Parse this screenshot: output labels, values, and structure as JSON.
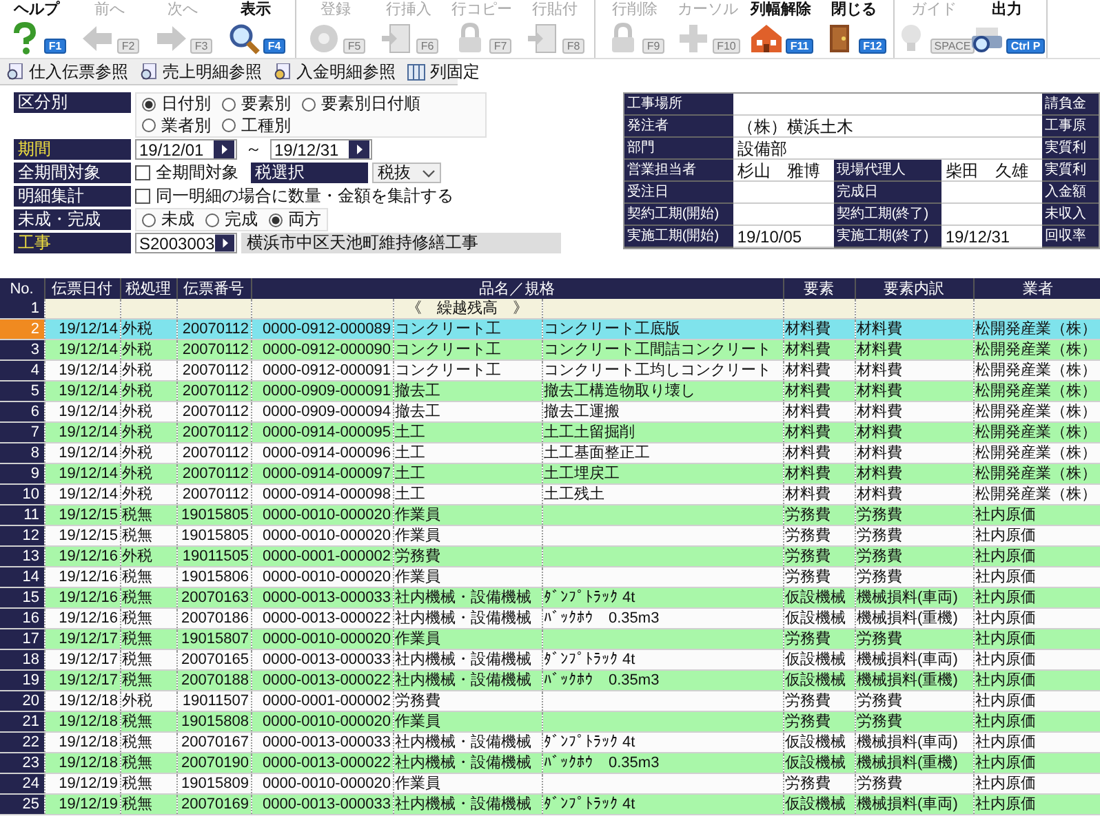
{
  "toolbar_groups": [
    {
      "buttons": [
        {
          "label": "ヘルプ",
          "key": "F1",
          "disabled": false
        },
        {
          "label": "前へ",
          "key": "F2",
          "disabled": true
        },
        {
          "label": "次へ",
          "key": "F3",
          "disabled": true
        },
        {
          "label": "表示",
          "key": "F4",
          "disabled": false
        }
      ]
    },
    {
      "buttons": [
        {
          "label": "登録",
          "key": "F5",
          "disabled": true
        },
        {
          "label": "行挿入",
          "key": "F6",
          "disabled": true
        },
        {
          "label": "行コピー",
          "key": "F7",
          "disabled": true
        },
        {
          "label": "行貼付",
          "key": "F8",
          "disabled": true
        }
      ]
    },
    {
      "buttons": [
        {
          "label": "行削除",
          "key": "F9",
          "disabled": true
        },
        {
          "label": "カーソル",
          "key": "F10",
          "disabled": true
        },
        {
          "label": "列幅解除",
          "key": "F11",
          "disabled": false
        },
        {
          "label": "閉じる",
          "key": "F12",
          "disabled": false
        }
      ]
    },
    {
      "buttons": [
        {
          "label": "ガイド",
          "key": "SPACE",
          "disabled": true
        },
        {
          "label": "出力",
          "key": "Ctrl P",
          "disabled": false
        }
      ]
    }
  ],
  "sub_toolbar": [
    {
      "label": "仕入伝票参照"
    },
    {
      "label": "売上明細参照"
    },
    {
      "label": "入金明細参照"
    },
    {
      "label": "列固定"
    }
  ],
  "filters": [
    {
      "kind": "radio",
      "label": "区分別",
      "required": false,
      "options": [
        {
          "label": "日付別",
          "selected": true
        },
        {
          "label": "要素別",
          "selected": false
        },
        {
          "label": "要素別日付順",
          "selected": false
        },
        {
          "label": "業者別",
          "selected": false
        },
        {
          "label": "工種別",
          "selected": false
        }
      ]
    },
    {
      "kind": "date_range",
      "label": "期間",
      "required": true,
      "from": "19/12/01",
      "separator": "～",
      "to": "19/12/31"
    },
    {
      "kind": "checkbox_select",
      "label": "全期間対象",
      "required": false,
      "checkbox": {
        "label": "全期間対象",
        "checked": false
      },
      "select_label": "税選択",
      "select_value": "税抜"
    },
    {
      "kind": "checkbox",
      "label": "明細集計",
      "required": false,
      "checkbox": {
        "label": "同一明細の場合に数量・金額を集計する",
        "checked": false
      }
    },
    {
      "kind": "radio",
      "label": "未成・完成",
      "required": false,
      "options": [
        {
          "label": "未成",
          "selected": false
        },
        {
          "label": "完成",
          "selected": false
        },
        {
          "label": "両方",
          "selected": true
        }
      ]
    },
    {
      "kind": "project",
      "label": "工事",
      "required": true,
      "code": "S2003003",
      "name": "横浜市中区天池町維持修繕工事"
    }
  ],
  "info": [
    {
      "fields": [
        {
          "label": "工事場所"
        }
      ],
      "side_label": "請負金"
    },
    {
      "fields": [
        {
          "label": "発注者",
          "value": "（株）横浜土木"
        }
      ],
      "side_label": "工事原"
    },
    {
      "fields": [
        {
          "label": "部門",
          "value": "設備部"
        }
      ],
      "side_label": "実質利"
    },
    {
      "fields": [
        {
          "label": "営業担当者",
          "value": "杉山　雅博"
        },
        {
          "label": "現場代理人",
          "value": "柴田　久雄"
        }
      ],
      "side_label": "実質利"
    },
    {
      "fields": [
        {
          "label": "受注日"
        },
        {
          "label": "完成日"
        }
      ],
      "side_label": "入金額"
    },
    {
      "fields": [
        {
          "label": "契約工期(開始)"
        },
        {
          "label": "契約工期(終了)"
        }
      ],
      "side_label": "未収入"
    },
    {
      "fields": [
        {
          "label": "実施工期(開始)",
          "value": "19/10/05"
        },
        {
          "label": "実施工期(終了)",
          "value": "19/12/31"
        }
      ],
      "side_label": "回収率"
    }
  ],
  "table": {
    "columns": [
      "No.",
      "伝票日付",
      "税処理",
      "伝票番号",
      "品名／規格",
      "要素",
      "要素内訳",
      "業者"
    ],
    "rows": [
      {
        "kind": "carryover",
        "no": "1",
        "item": "《　繰越残高　》",
        "selected": false
      },
      {
        "kind": "entry",
        "no": "2",
        "date": "19/12/14",
        "tax": "外税",
        "slip": "20070112",
        "code": "0000-0912-000089",
        "item": "コンクリート工",
        "spec": "コンクリート工底版",
        "element": "材料費",
        "breakdown": "材料費",
        "vendor": "松開発産業（株）",
        "selected": true
      },
      {
        "kind": "entry",
        "no": "3",
        "date": "19/12/14",
        "tax": "外税",
        "slip": "20070112",
        "code": "0000-0912-000090",
        "item": "コンクリート工",
        "spec": "コンクリート工間詰コンクリート",
        "element": "材料費",
        "breakdown": "材料費",
        "vendor": "松開発産業（株）",
        "selected": false
      },
      {
        "kind": "entry",
        "no": "4",
        "date": "19/12/14",
        "tax": "外税",
        "slip": "20070112",
        "code": "0000-0912-000091",
        "item": "コンクリート工",
        "spec": "コンクリート工均しコンクリート",
        "element": "材料費",
        "breakdown": "材料費",
        "vendor": "松開発産業（株）",
        "selected": false
      },
      {
        "kind": "entry",
        "no": "5",
        "date": "19/12/14",
        "tax": "外税",
        "slip": "20070112",
        "code": "0000-0909-000091",
        "item": "撤去工",
        "spec": "撤去工構造物取り壊し",
        "element": "材料費",
        "breakdown": "材料費",
        "vendor": "松開発産業（株）",
        "selected": false
      },
      {
        "kind": "entry",
        "no": "6",
        "date": "19/12/14",
        "tax": "外税",
        "slip": "20070112",
        "code": "0000-0909-000094",
        "item": "撤去工",
        "spec": "撤去工運搬",
        "element": "材料費",
        "breakdown": "材料費",
        "vendor": "松開発産業（株）",
        "selected": false
      },
      {
        "kind": "entry",
        "no": "7",
        "date": "19/12/14",
        "tax": "外税",
        "slip": "20070112",
        "code": "0000-0914-000095",
        "item": "土工",
        "spec": "土工土留掘削",
        "element": "材料費",
        "breakdown": "材料費",
        "vendor": "松開発産業（株）",
        "selected": false
      },
      {
        "kind": "entry",
        "no": "8",
        "date": "19/12/14",
        "tax": "外税",
        "slip": "20070112",
        "code": "0000-0914-000096",
        "item": "土工",
        "spec": "土工基面整正工",
        "element": "材料費",
        "breakdown": "材料費",
        "vendor": "松開発産業（株）",
        "selected": false
      },
      {
        "kind": "entry",
        "no": "9",
        "date": "19/12/14",
        "tax": "外税",
        "slip": "20070112",
        "code": "0000-0914-000097",
        "item": "土工",
        "spec": "土工埋戻工",
        "element": "材料費",
        "breakdown": "材料費",
        "vendor": "松開発産業（株）",
        "selected": false
      },
      {
        "kind": "entry",
        "no": "10",
        "date": "19/12/14",
        "tax": "外税",
        "slip": "20070112",
        "code": "0000-0914-000098",
        "item": "土工",
        "spec": "土工残土",
        "element": "材料費",
        "breakdown": "材料費",
        "vendor": "松開発産業（株）",
        "selected": false
      },
      {
        "kind": "entry",
        "no": "11",
        "date": "19/12/15",
        "tax": "税無",
        "slip": "19015805",
        "code": "0000-0010-000020",
        "item": "作業員",
        "element": "労務費",
        "breakdown": "労務費",
        "vendor": "社内原価",
        "selected": false
      },
      {
        "kind": "entry",
        "no": "12",
        "date": "19/12/15",
        "tax": "税無",
        "slip": "19015805",
        "code": "0000-0010-000020",
        "item": "作業員",
        "element": "労務費",
        "breakdown": "労務費",
        "vendor": "社内原価",
        "selected": false
      },
      {
        "kind": "entry",
        "no": "13",
        "date": "19/12/16",
        "tax": "外税",
        "slip": "19011505",
        "code": "0000-0001-000002",
        "item": "労務費",
        "element": "労務費",
        "breakdown": "労務費",
        "vendor": "社内原価",
        "selected": false
      },
      {
        "kind": "entry",
        "no": "14",
        "date": "19/12/16",
        "tax": "税無",
        "slip": "19015806",
        "code": "0000-0010-000020",
        "item": "作業員",
        "element": "労務費",
        "breakdown": "労務費",
        "vendor": "社内原価",
        "selected": false
      },
      {
        "kind": "entry",
        "no": "15",
        "date": "19/12/16",
        "tax": "税無",
        "slip": "20070163",
        "code": "0000-0013-000033",
        "item": "社内機械・設備機械",
        "spec": "ﾀﾞﾝﾌﾟﾄﾗｯｸ 4t",
        "element": "仮設機械",
        "breakdown": "機械損料(車両)",
        "vendor": "社内原価",
        "selected": false
      },
      {
        "kind": "entry",
        "no": "16",
        "date": "19/12/16",
        "tax": "税無",
        "slip": "20070186",
        "code": "0000-0013-000022",
        "item": "社内機械・設備機械",
        "spec": "ﾊﾞｯｸﾎｳ　0.35m3",
        "element": "仮設機械",
        "breakdown": "機械損料(重機)",
        "vendor": "社内原価",
        "selected": false
      },
      {
        "kind": "entry",
        "no": "17",
        "date": "19/12/17",
        "tax": "税無",
        "slip": "19015807",
        "code": "0000-0010-000020",
        "item": "作業員",
        "element": "労務費",
        "breakdown": "労務費",
        "vendor": "社内原価",
        "selected": false
      },
      {
        "kind": "entry",
        "no": "18",
        "date": "19/12/17",
        "tax": "税無",
        "slip": "20070165",
        "code": "0000-0013-000033",
        "item": "社内機械・設備機械",
        "spec": "ﾀﾞﾝﾌﾟﾄﾗｯｸ 4t",
        "element": "仮設機械",
        "breakdown": "機械損料(車両)",
        "vendor": "社内原価",
        "selected": false
      },
      {
        "kind": "entry",
        "no": "19",
        "date": "19/12/17",
        "tax": "税無",
        "slip": "20070188",
        "code": "0000-0013-000022",
        "item": "社内機械・設備機械",
        "spec": "ﾊﾞｯｸﾎｳ　0.35m3",
        "element": "仮設機械",
        "breakdown": "機械損料(重機)",
        "vendor": "社内原価",
        "selected": false
      },
      {
        "kind": "entry",
        "no": "20",
        "date": "19/12/18",
        "tax": "外税",
        "slip": "19011507",
        "code": "0000-0001-000002",
        "item": "労務費",
        "element": "労務費",
        "breakdown": "労務費",
        "vendor": "社内原価",
        "selected": false
      },
      {
        "kind": "entry",
        "no": "21",
        "date": "19/12/18",
        "tax": "税無",
        "slip": "19015808",
        "code": "0000-0010-000020",
        "item": "作業員",
        "element": "労務費",
        "breakdown": "労務費",
        "vendor": "社内原価",
        "selected": false
      },
      {
        "kind": "entry",
        "no": "22",
        "date": "19/12/18",
        "tax": "税無",
        "slip": "20070167",
        "code": "0000-0013-000033",
        "item": "社内機械・設備機械",
        "spec": "ﾀﾞﾝﾌﾟﾄﾗｯｸ 4t",
        "element": "仮設機械",
        "breakdown": "機械損料(車両)",
        "vendor": "社内原価",
        "selected": false
      },
      {
        "kind": "entry",
        "no": "23",
        "date": "19/12/18",
        "tax": "税無",
        "slip": "20070190",
        "code": "0000-0013-000022",
        "item": "社内機械・設備機械",
        "spec": "ﾊﾞｯｸﾎｳ　0.35m3",
        "element": "仮設機械",
        "breakdown": "機械損料(重機)",
        "vendor": "社内原価",
        "selected": false
      },
      {
        "kind": "entry",
        "no": "24",
        "date": "19/12/19",
        "tax": "税無",
        "slip": "19015809",
        "code": "0000-0010-000020",
        "item": "作業員",
        "element": "労務費",
        "breakdown": "労務費",
        "vendor": "社内原価",
        "selected": false
      },
      {
        "kind": "entry",
        "no": "25",
        "date": "19/12/19",
        "tax": "税無",
        "slip": "20070169",
        "code": "0000-0013-000033",
        "item": "社内機械・設備機械",
        "spec": "ﾀﾞﾝﾌﾟﾄﾗｯｸ 4t",
        "element": "仮設機械",
        "breakdown": "機械損料(車両)",
        "vendor": "社内原価",
        "selected": false
      }
    ]
  }
}
